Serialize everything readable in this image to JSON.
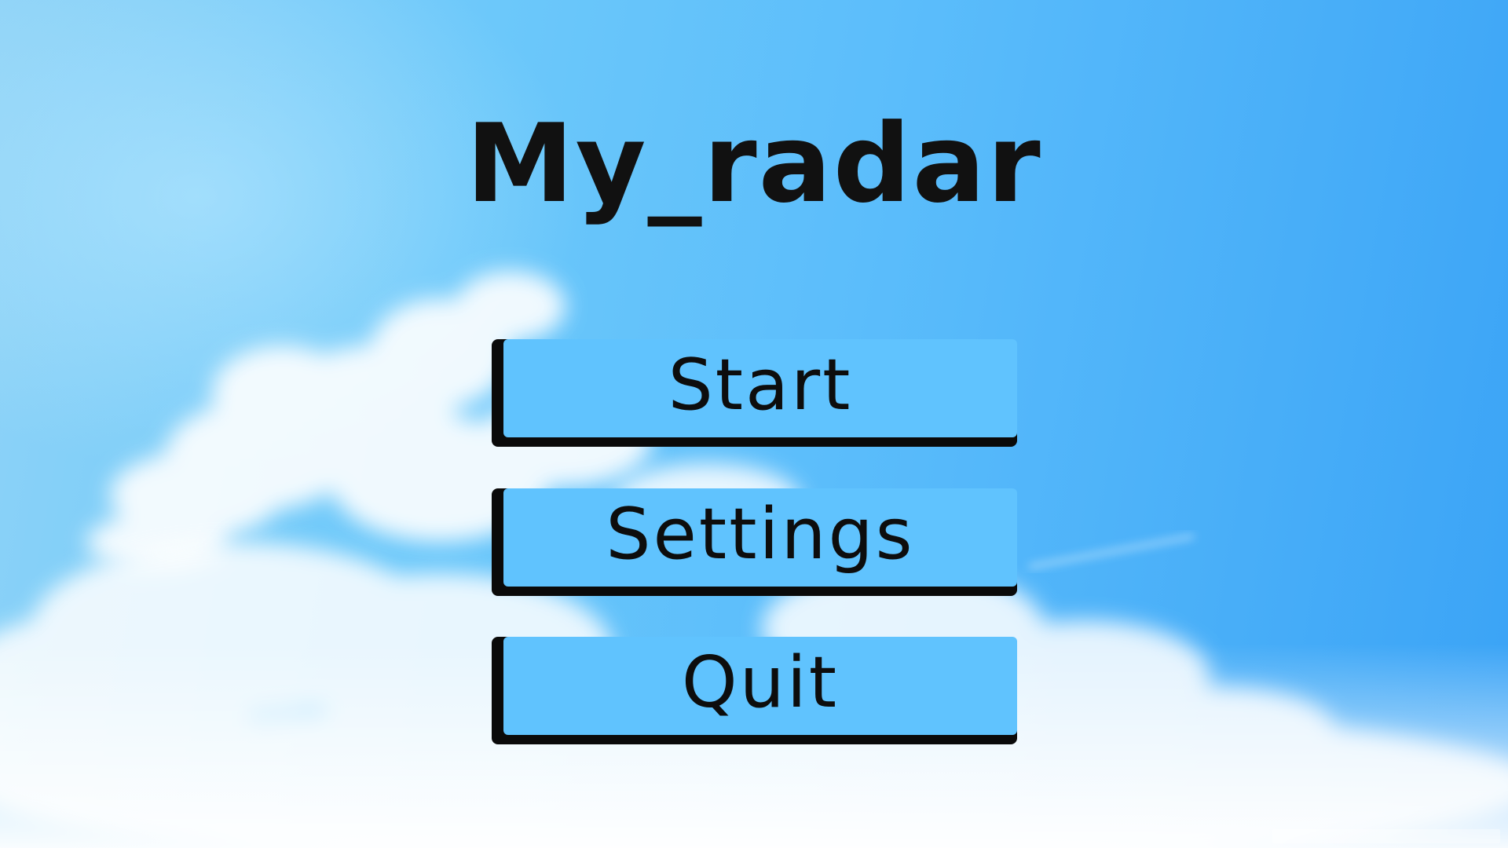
{
  "game": {
    "title": "My_radar"
  },
  "menu": {
    "start_label": "Start",
    "settings_label": "Settings",
    "quit_label": "Quit"
  },
  "colors": {
    "sky_top": "#6cc8fa",
    "sky_right": "#3aa3f6",
    "button_face": "#60c3fe",
    "button_shadow": "#0a0a0a",
    "text": "#111111"
  }
}
